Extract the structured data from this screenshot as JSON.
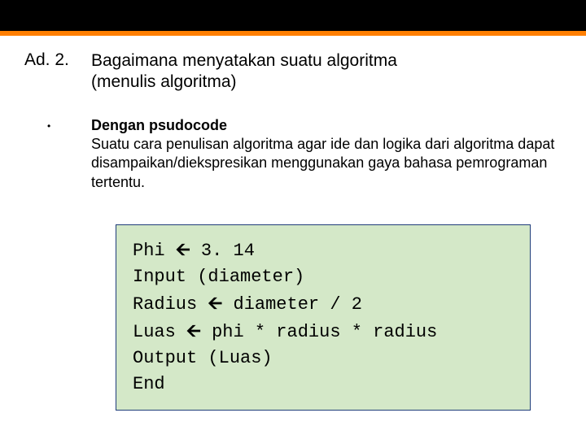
{
  "heading": {
    "prefix": "Ad. 2.",
    "line1": "Bagaimana menyatakan suatu algoritma",
    "line2": "(menulis algoritma)"
  },
  "bullet": {
    "dot": "•",
    "title": "Dengan psudocode",
    "desc": "Suatu cara  penulisan algoritma agar ide dan logika dari algoritma dapat disampaikan/diekspresikan menggunakan gaya bahasa pemrograman tertentu."
  },
  "code": {
    "l1a": "Phi ",
    "l1b": " 3. 14",
    "l2": "Input (diameter)",
    "l3a": "Radius ",
    "l3b": " diameter / 2",
    "l4a": "Luas ",
    "l4b": " phi * radius * radius",
    "l5": "Output (Luas)",
    "l6": "End",
    "arrow": "🡨"
  }
}
